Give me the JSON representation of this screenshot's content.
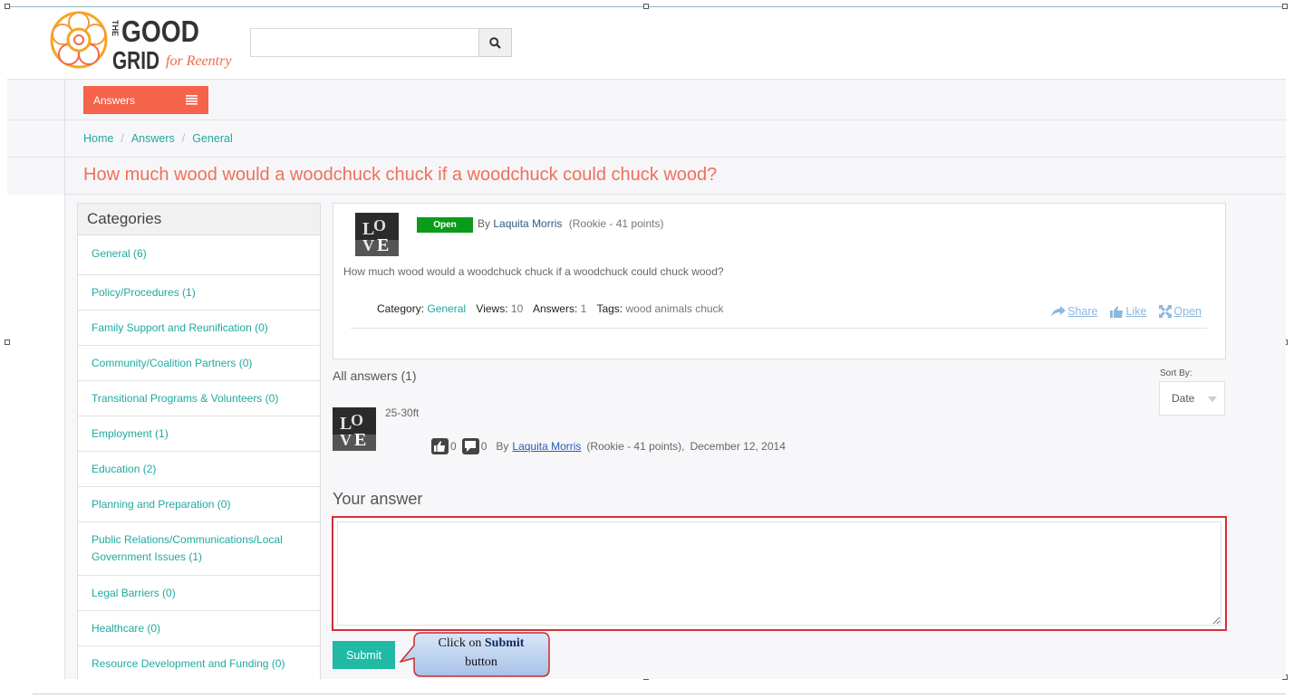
{
  "header": {
    "logo_text": "THE GOOD GRID for Reentry",
    "search_placeholder": "",
    "search_icon": "search-icon"
  },
  "nav": {
    "answers_label": "Answers",
    "menu_icon": "hamburger-icon"
  },
  "breadcrumb": [
    "Home",
    "Answers",
    "General"
  ],
  "page_title": "How much wood would a woodchuck chuck if a woodchuck could chuck wood?",
  "categories": {
    "title": "Categories",
    "items": [
      "General (6)",
      "Policy/Procedures (1)",
      "Family Support and Reunification (0)",
      "Community/Coalition Partners (0)",
      "Transitional Programs & Volunteers (0)",
      "Employment (1)",
      "Education (2)",
      "Planning and Preparation (0)",
      "Public Relations/Communications/Local Government Issues (1)",
      "Legal Barriers (0)",
      "Healthcare (0)",
      "Resource Development and Funding (0)"
    ]
  },
  "question": {
    "status": "Open",
    "by_label": "By",
    "author": "Laquita Morris",
    "points": "(Rookie - 41 points)",
    "body": "How much wood would a woodchuck chuck if a woodchuck could chuck wood?",
    "category_label": "Category:",
    "category": "General",
    "views_label": "Views:",
    "views": "10",
    "answers_label": "Answers:",
    "answers": "1",
    "tags_label": "Tags:",
    "tags": "wood animals chuck",
    "actions": {
      "share": "Share",
      "like": "Like",
      "open": "Open"
    }
  },
  "answers_section": {
    "title": "All answers (1)",
    "sort_label": "Sort By:",
    "sort_value": "Date",
    "answer": {
      "text": "25-30ft",
      "likes": "0",
      "comments": "0",
      "by_label": "By",
      "author": "Laquita Morris",
      "points": "(Rookie - 41 points),",
      "date": "December 12, 2014"
    }
  },
  "form": {
    "title": "Your answer",
    "textarea_value": "",
    "submit_label": "Submit"
  },
  "callout": {
    "prefix": "Click on",
    "bold": "Submit",
    "suffix": "button"
  },
  "colors": {
    "accent_orange": "#f5634a",
    "title_salmon": "#f0705a",
    "link_teal": "#1fa9a0",
    "status_green": "#0a9b1a",
    "submit_teal": "#1fb9a4",
    "highlight_red": "#d0313a"
  }
}
